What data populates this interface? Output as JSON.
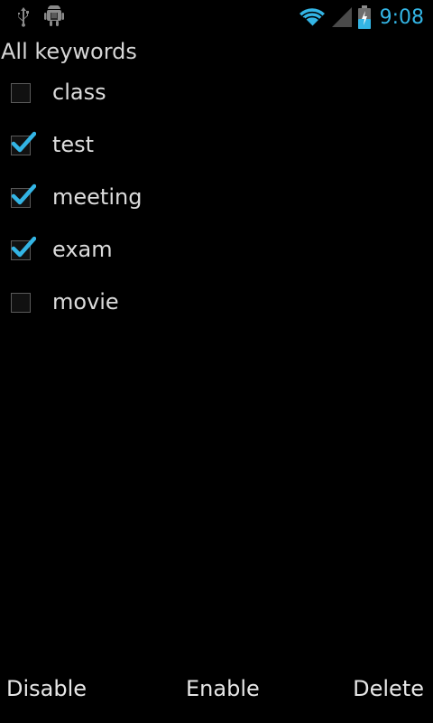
{
  "status_bar": {
    "time": "9:08",
    "icons_left": [
      "usb-icon",
      "android-debug-icon"
    ],
    "icons_right": [
      "wifi-icon",
      "signal-icon",
      "battery-charging-icon"
    ],
    "accent_color": "#33b5e5"
  },
  "list": {
    "title": "All keywords",
    "items": [
      {
        "label": "class",
        "checked": false
      },
      {
        "label": "test",
        "checked": true
      },
      {
        "label": "meeting",
        "checked": true
      },
      {
        "label": "exam",
        "checked": true
      },
      {
        "label": "movie",
        "checked": false
      }
    ]
  },
  "actions": {
    "disable_label": "Disable",
    "enable_label": "Enable",
    "delete_label": "Delete"
  },
  "colors": {
    "background": "#000000",
    "check": "#33b5e5",
    "text": "#dcdcdc"
  }
}
